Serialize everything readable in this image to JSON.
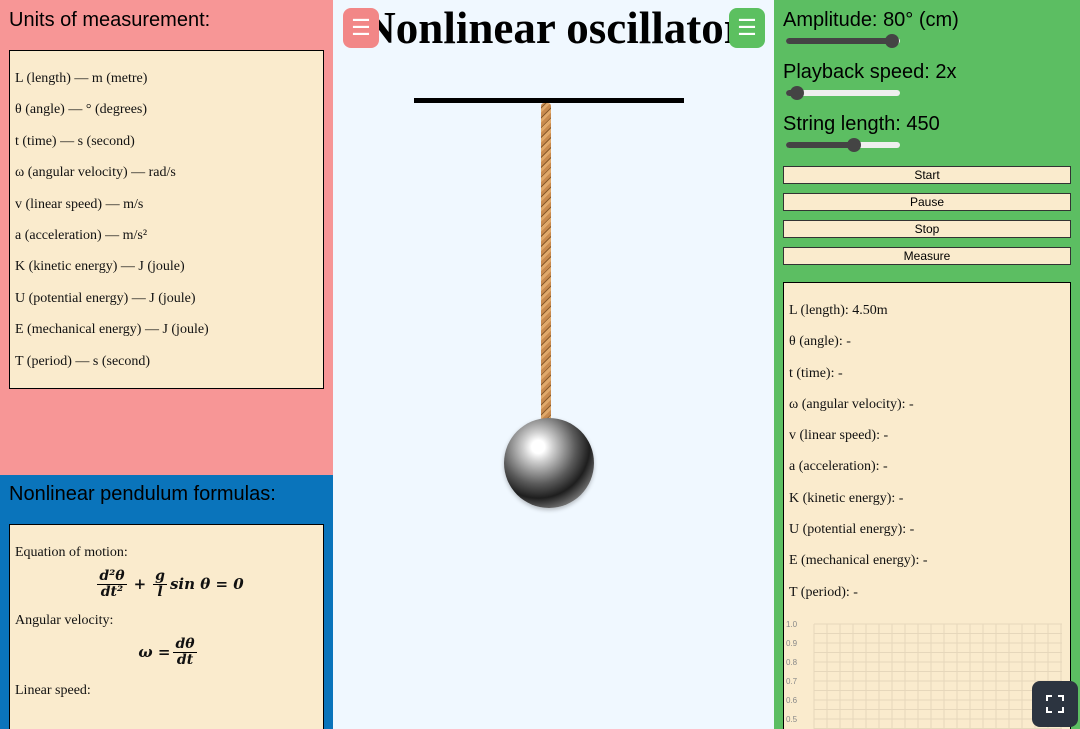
{
  "units": {
    "title": "Units of measurement:",
    "items": [
      "L (length) — m (metre)",
      "θ (angle) — ° (degrees)",
      "t (time) — s (second)",
      "ω (angular velocity) — rad/s",
      "v (linear speed) — m/s",
      "a (acceleration) — m/s²",
      "K (kinetic energy) — J (joule)",
      "U (potential energy) — J (joule)",
      "E (mechanical energy) — J (joule)",
      "T (period) — s (second)"
    ]
  },
  "formulas": {
    "title": "Nonlinear pendulum formulas:",
    "equation_label": "Equation of motion:",
    "eq1": {
      "num1": "d²θ",
      "den1": "dt²",
      "plus": "+",
      "num2": "g",
      "den2": "l",
      "rest": "sin θ = 0"
    },
    "angular_label": "Angular velocity:",
    "eq2": {
      "lhs": "ω =",
      "num": "dθ",
      "den": "dt"
    },
    "linear_label": "Linear speed:"
  },
  "stage": {
    "title": "Nonlinear oscillator",
    "menu_icon": "☰"
  },
  "controls": {
    "amplitude": {
      "label": "Amplitude:",
      "value": "80° (cm)",
      "fraction": 0.93
    },
    "speed": {
      "label": "Playback speed:",
      "value": "2x",
      "fraction": 0.1
    },
    "length": {
      "label": "String length:",
      "value": "450",
      "fraction": 0.6
    },
    "buttons": {
      "start": "Start",
      "pause": "Pause",
      "stop": "Stop",
      "measure": "Measure"
    }
  },
  "readout": {
    "items": [
      "L (length): 4.50m",
      "θ (angle): -",
      "t (time): -",
      "ω (angular velocity): -",
      "v (linear speed): -",
      "a (acceleration): -",
      "K (kinetic energy): -",
      "U (potential energy): -",
      "E (mechanical energy): -",
      "T (period): -"
    ],
    "graph_ticks": [
      "1.0",
      "0.9",
      "0.8",
      "0.7",
      "0.6",
      "0.5"
    ]
  },
  "colors": {
    "units_bg": "#f79696",
    "formulas_bg": "#0a74bb",
    "controls_bg": "#5cbe62",
    "stage_bg": "#f0f8ff",
    "box_bg": "#faebcd"
  }
}
